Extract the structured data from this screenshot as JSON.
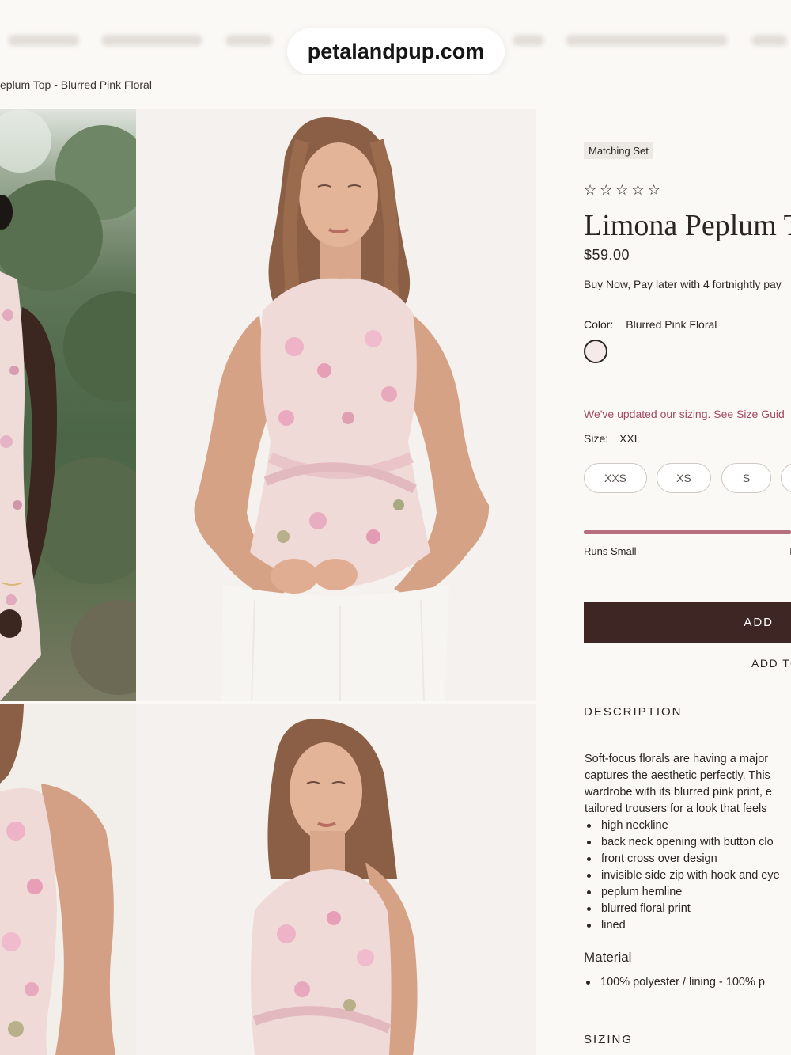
{
  "browser": {
    "url": "petalandpup.com"
  },
  "breadcrumb": "eplum Top - Blurred Pink Floral",
  "product": {
    "tag": "Matching Set",
    "rating": 0,
    "stars_max": 5,
    "title": "Limona Peplum To",
    "price": "$59.00",
    "bnpl": "Buy Now, Pay later with 4 fortnightly pay",
    "color_label": "Color:",
    "color_value": "Blurred Pink Floral",
    "swatch_color": "#f4eaea",
    "sizing_note": "We've updated our sizing. See Size Guid",
    "size_label": "Size:",
    "size_value": "XXL",
    "sizes": [
      "XXS",
      "XS",
      "S"
    ],
    "fit_label": "Runs Small",
    "fit_right": "T",
    "add_to_cart": "ADD",
    "add_to_wishlist": "ADD TO"
  },
  "description": {
    "heading": "DESCRIPTION",
    "lines": [
      "Soft-focus florals are having a major",
      "captures the aesthetic perfectly. This",
      "wardrobe with its blurred pink print, e",
      "tailored trousers for a look that feels"
    ],
    "bullets": [
      "high neckline",
      "back neck opening with button clo",
      "front cross over design",
      "invisible side zip with hook and eye",
      "peplum hemline",
      "blurred floral print",
      "lined"
    ]
  },
  "material": {
    "heading": "Material",
    "items": [
      "100% polyester / lining - 100% p"
    ]
  },
  "sizing": {
    "heading": "SIZING"
  },
  "colors": {
    "accent": "#3e2624",
    "pink": "#a54b63",
    "fitbar": "#b76e7e"
  }
}
